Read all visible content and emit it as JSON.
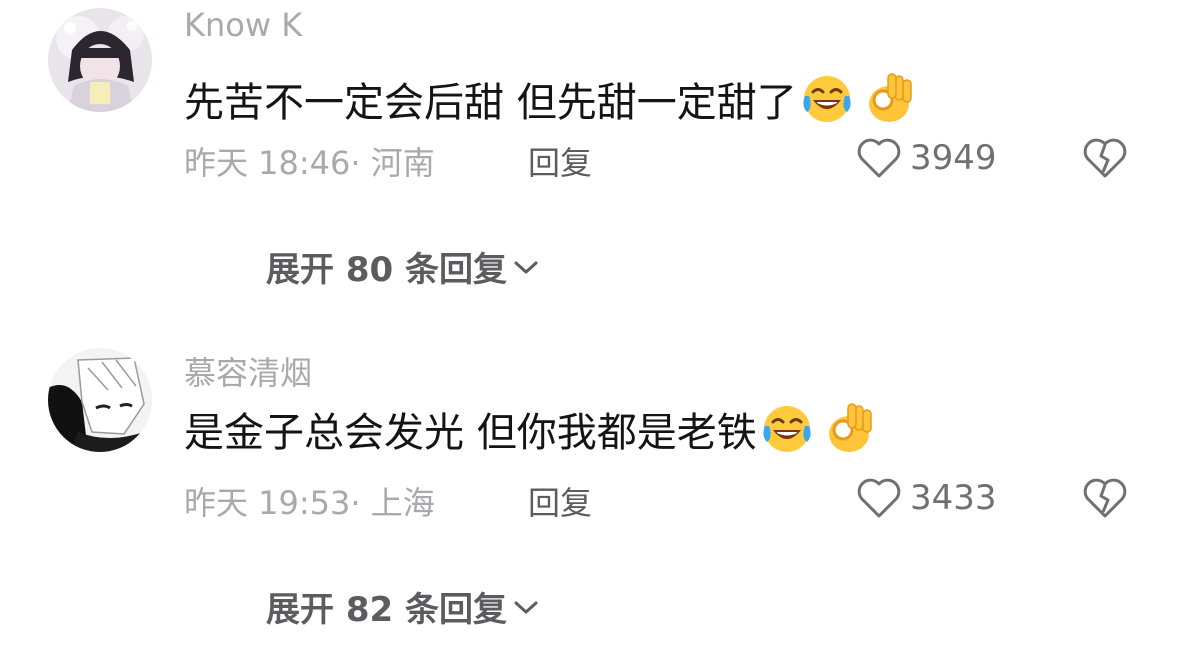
{
  "comments": [
    {
      "username": "Know K",
      "content": "先苦不一定会后甜 但先甜一定甜了",
      "emojis": [
        "laugh-cry-emoji",
        "ok-hand-emoji"
      ],
      "time": "昨天 18:46",
      "location": "· 河南",
      "reply_label": "回复",
      "like_count": "3949",
      "expand_label": "展开 80 条回复"
    },
    {
      "username": "慕容清烟",
      "content": "是金子总会发光 但你我都是老铁",
      "emojis": [
        "laugh-cry-emoji",
        "ok-hand-emoji"
      ],
      "time": "昨天 19:53",
      "location": "· 上海",
      "reply_label": "回复",
      "like_count": "3433",
      "expand_label": "展开 82 条回复"
    }
  ],
  "icons": {
    "like": "heart-outline-icon",
    "dislike": "broken-heart-icon",
    "expand": "chevron-down-icon"
  },
  "colors": {
    "username": "#a9a9ad",
    "content": "#141416",
    "meta": "#a9a9ad",
    "action": "#5c5c60"
  }
}
